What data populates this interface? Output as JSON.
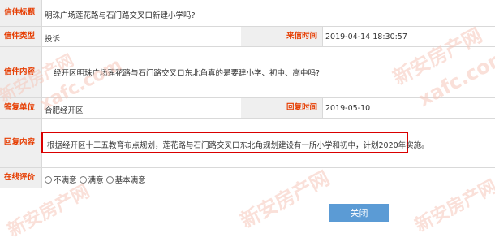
{
  "fields": {
    "title_label": "信件标题",
    "title_value": "明珠广场莲花路与石门路交叉口新建小学吗?",
    "type_label": "信件类型",
    "type_value": "投诉",
    "date_label": "来信时间",
    "date_value": "2019-04-14 18:30:57",
    "content_label": "信件内容",
    "content_value": "经开区明珠广场莲花路与石门路交叉口东北角真的是要建小学、初中、高中吗?",
    "org_label": "答复单位",
    "org_value": "合肥经开区",
    "reply_date_label": "回复时间",
    "reply_date_value": "2019-05-10",
    "reply_label": "回复内容",
    "reply_value": "根据经开区十三五教育布点规划，莲花路与石门路交叉口东北角规划建设有一所小学和初中，计划2020年实施。",
    "rating_label": "在线评价",
    "rating_options": [
      "不满意",
      "满意",
      "基本满意"
    ]
  },
  "close_button": "关闭",
  "watermark": {
    "text1": "新安房产网",
    "text2": "xafc.com"
  }
}
